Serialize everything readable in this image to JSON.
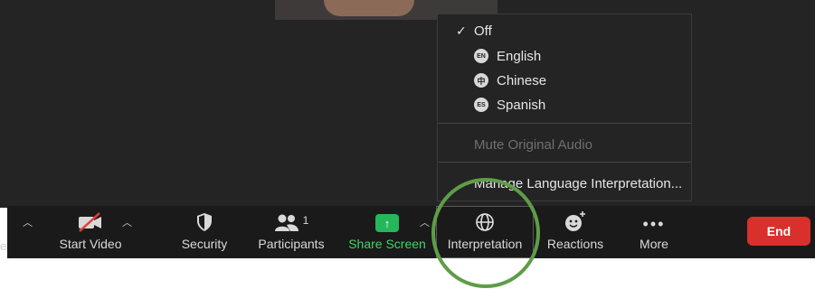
{
  "menu": {
    "off_label": "Off",
    "languages": [
      {
        "code": "EN",
        "name": "English"
      },
      {
        "code": "中",
        "name": "Chinese"
      },
      {
        "code": "ES",
        "name": "Spanish"
      }
    ],
    "mute_original": "Mute Original Audio",
    "manage": "Manage Language Interpretation..."
  },
  "toolbar": {
    "edge_label": "e",
    "start_video": "Start Video",
    "security": "Security",
    "participants": "Participants",
    "participants_count": "1",
    "share_screen": "Share Screen",
    "interpretation": "Interpretation",
    "reactions": "Reactions",
    "more": "More",
    "end": "End"
  },
  "colors": {
    "share_green": "#3fd46a",
    "end_red": "#d9302c",
    "highlight_circle": "#5e9d48"
  }
}
